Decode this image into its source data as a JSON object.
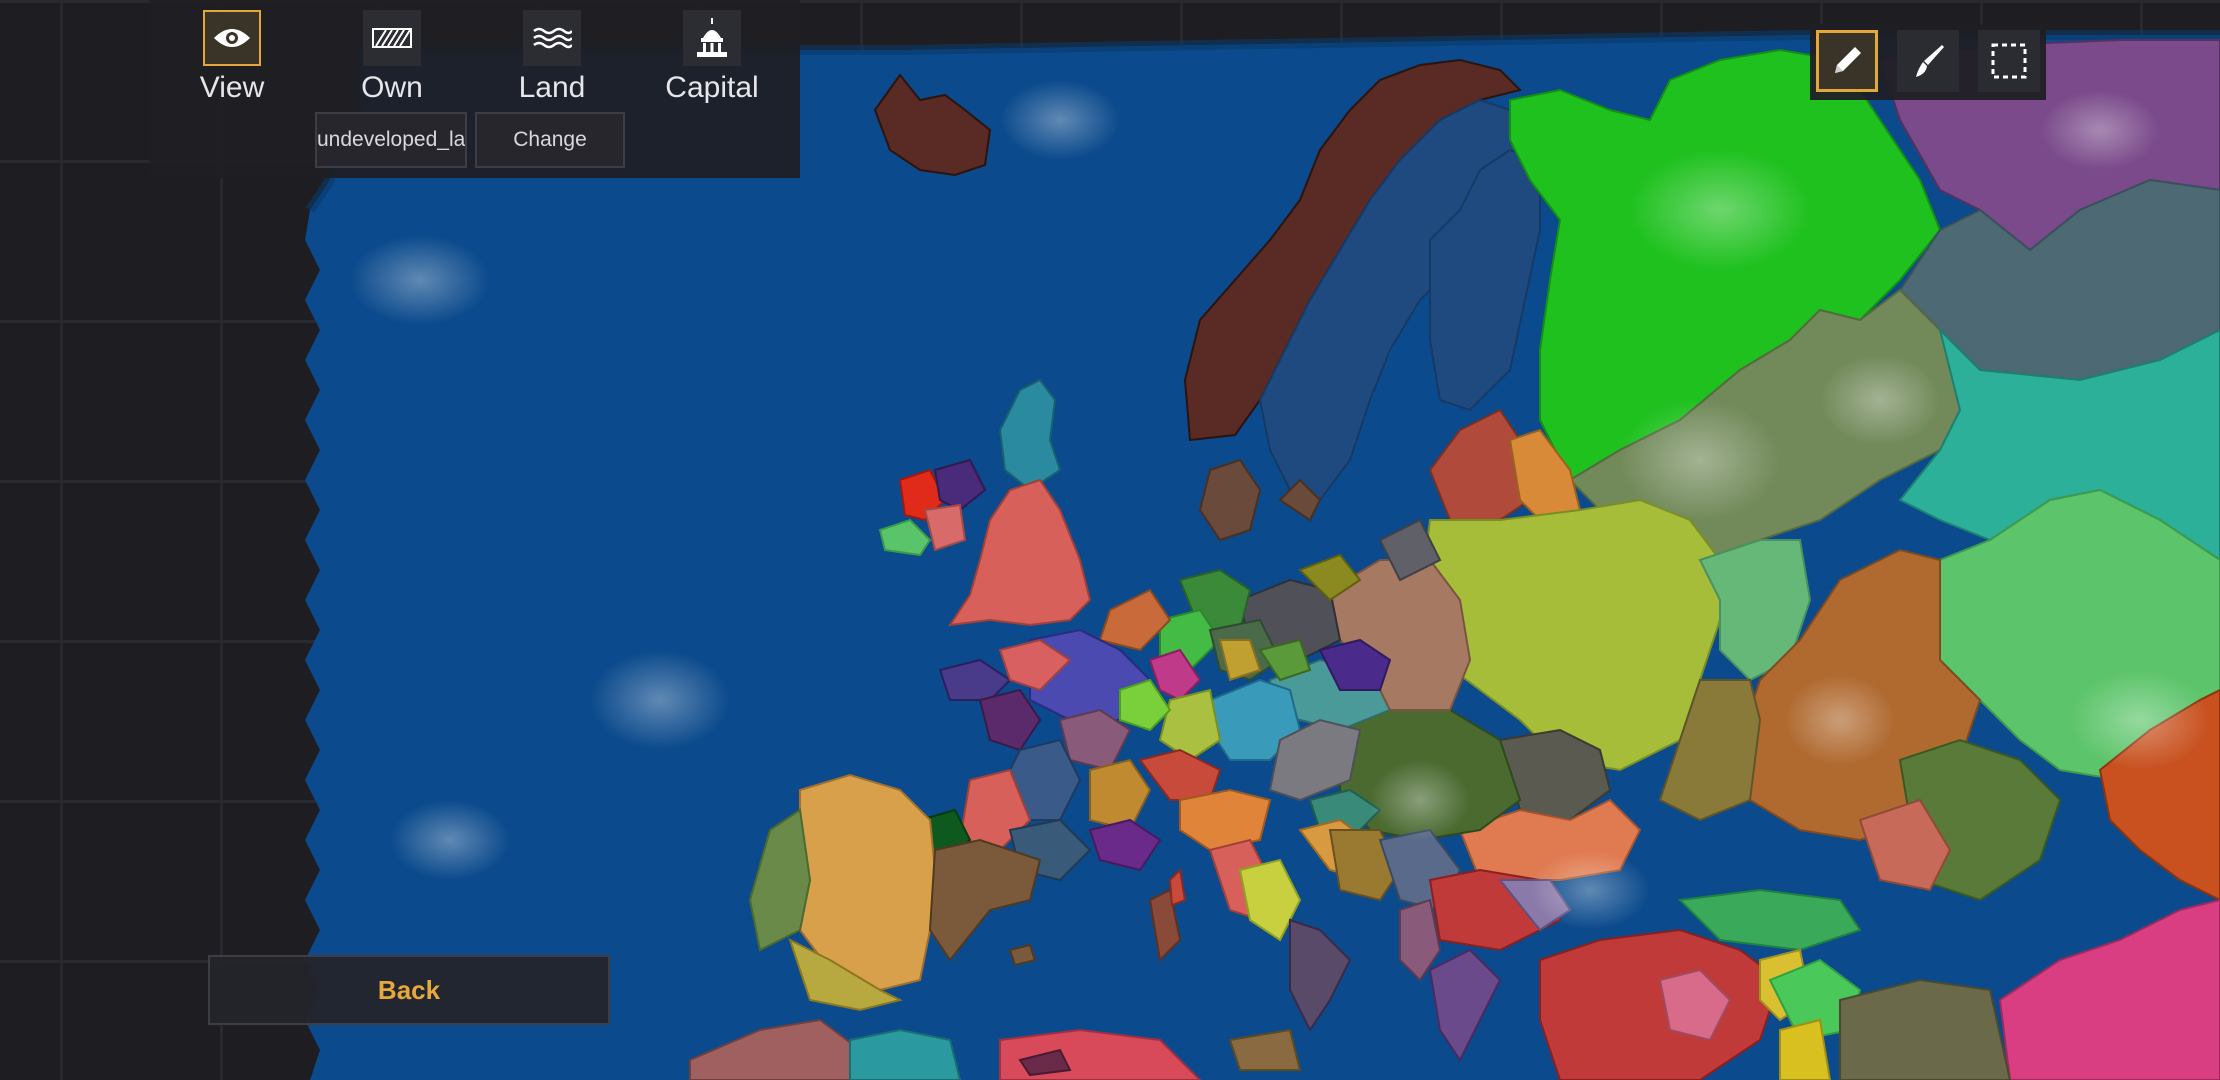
{
  "toolbar": {
    "modes": [
      {
        "label": "View",
        "icon": "eye-icon",
        "active": true
      },
      {
        "label": "Own",
        "icon": "hatched-own-icon",
        "active": false
      },
      {
        "label": "Land",
        "icon": "waves-land-icon",
        "active": false
      },
      {
        "label": "Capital",
        "icon": "capitol-building-icon",
        "active": false
      }
    ],
    "field_value": "undeveloped_land",
    "change_label": "Change"
  },
  "tools": [
    {
      "name": "pencil-icon",
      "active": true
    },
    {
      "name": "brush-icon",
      "active": false
    },
    {
      "name": "select-rect-icon",
      "active": false
    }
  ],
  "back_label": "Back",
  "colors": {
    "accent": "#e2a83b",
    "sea": "#0b4a8c",
    "back_text": "#e8a93a"
  }
}
